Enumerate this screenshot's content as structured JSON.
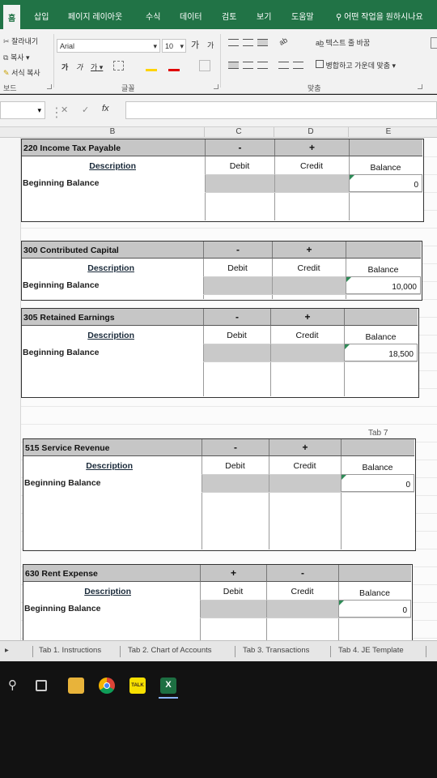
{
  "ribbon": {
    "tabs": [
      "홈",
      "삽입",
      "페이지 레이아웃",
      "수식",
      "데이터",
      "검토",
      "보기",
      "도움말"
    ],
    "tell_me": "어떤 작업을 원하시나요",
    "clipboard": {
      "cut": "잘라내기",
      "copy": "복사",
      "format_painter": "서식 복사",
      "label": "보드"
    },
    "font": {
      "name": "Arial",
      "size": "10",
      "grow": "가",
      "shrink": "가",
      "bold": "가",
      "italic": "가",
      "underline": "가",
      "label": "글꼴"
    },
    "alignment": {
      "wrap_text": "텍스트 줄 바꿈",
      "merge_center": "병합하고 가운데 맞춤",
      "label": "맞춤"
    }
  },
  "formula_bar": {
    "fx": "fx",
    "cancel": "✕",
    "enter": "✓",
    "value": ""
  },
  "columns": [
    "B",
    "C",
    "D",
    "E"
  ],
  "accounts": [
    {
      "title": "220 Income Tax Payable",
      "sign_left": "-",
      "sign_right": "+",
      "desc": "Description",
      "debit": "Debit",
      "credit": "Credit",
      "balance_label": "Balance",
      "beginning": "Beginning Balance",
      "balance": "0"
    },
    {
      "title": "300 Contributed Capital",
      "sign_left": "-",
      "sign_right": "+",
      "desc": "Description",
      "debit": "Debit",
      "credit": "Credit",
      "balance_label": "Balance",
      "beginning": "Beginning Balance",
      "balance": "10,000"
    },
    {
      "title": "305 Retained Earnings",
      "sign_left": "-",
      "sign_right": "+",
      "desc": "Description",
      "debit": "Debit",
      "credit": "Credit",
      "balance_label": "Balance",
      "beginning": "Beginning Balance",
      "balance": "18,500"
    },
    {
      "title": "515 Service Revenue",
      "sign_left": "-",
      "sign_right": "+",
      "desc": "Description",
      "debit": "Debit",
      "credit": "Credit",
      "balance_label": "Balance",
      "beginning": "Beginning Balance",
      "balance": "0"
    },
    {
      "title": "630 Rent Expense",
      "sign_left": "+",
      "sign_right": "-",
      "desc": "Description",
      "debit": "Debit",
      "credit": "Credit",
      "balance_label": "Balance",
      "beginning": "Beginning Balance",
      "balance": "0"
    }
  ],
  "tab_note": "Tab 7",
  "sheet_tabs": [
    "Tab 1. Instructions",
    "Tab 2. Chart of Accounts",
    "Tab 3. Transactions",
    "Tab 4. JE Template"
  ],
  "taskbar": {
    "icons": [
      "search-icon",
      "task-view-icon",
      "file-explorer-icon",
      "chrome-icon",
      "kakaotalk-icon",
      "excel-icon"
    ],
    "kakao_label": "TALK",
    "excel_label": "X"
  },
  "colors": {
    "excel_green": "#217346",
    "header_gray": "#c6c6c6"
  }
}
